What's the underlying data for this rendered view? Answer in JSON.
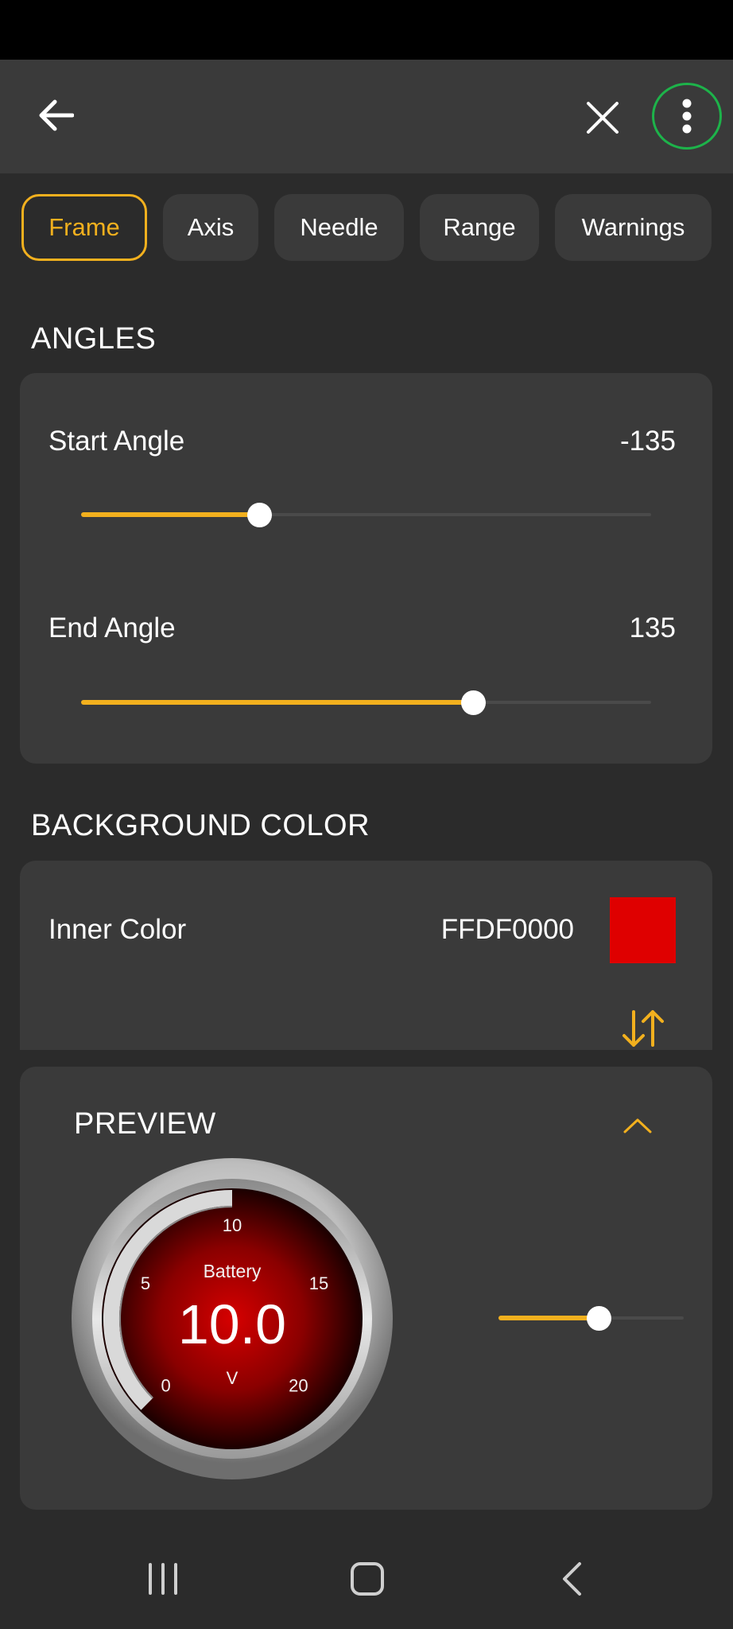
{
  "tabs": [
    {
      "label": "Frame",
      "active": true
    },
    {
      "label": "Axis",
      "active": false
    },
    {
      "label": "Needle",
      "active": false
    },
    {
      "label": "Range",
      "active": false
    },
    {
      "label": "Warnings",
      "active": false
    }
  ],
  "angles": {
    "title": "ANGLES",
    "start": {
      "label": "Start Angle",
      "value": "-135",
      "fraction": 0.313
    },
    "end": {
      "label": "End Angle",
      "value": "135",
      "fraction": 0.688
    }
  },
  "background": {
    "title": "BACKGROUND COLOR",
    "inner": {
      "label": "Inner Color",
      "value": "FFDF0000",
      "swatch_color": "#df0000"
    }
  },
  "preview": {
    "title": "PREVIEW",
    "gauge": {
      "label": "Battery",
      "value": "10.0",
      "unit": "V",
      "ticks": [
        "0",
        "5",
        "10",
        "15",
        "20"
      ],
      "min": 0,
      "max": 20,
      "current": 10
    },
    "slider_fraction": 0.54
  },
  "colors": {
    "accent": "#f2b01e",
    "card": "#3a3a3a",
    "background": "#2b2b2b",
    "highlight_ring": "#1db34a"
  },
  "icons": {
    "back": "arrow-left-icon",
    "close": "close-icon",
    "more": "more-vertical-icon",
    "swap": "swap-vertical-icon",
    "collapse": "chevron-up-icon",
    "nav_recent": "recent-apps-icon",
    "nav_home": "home-icon",
    "nav_back": "nav-back-icon"
  }
}
